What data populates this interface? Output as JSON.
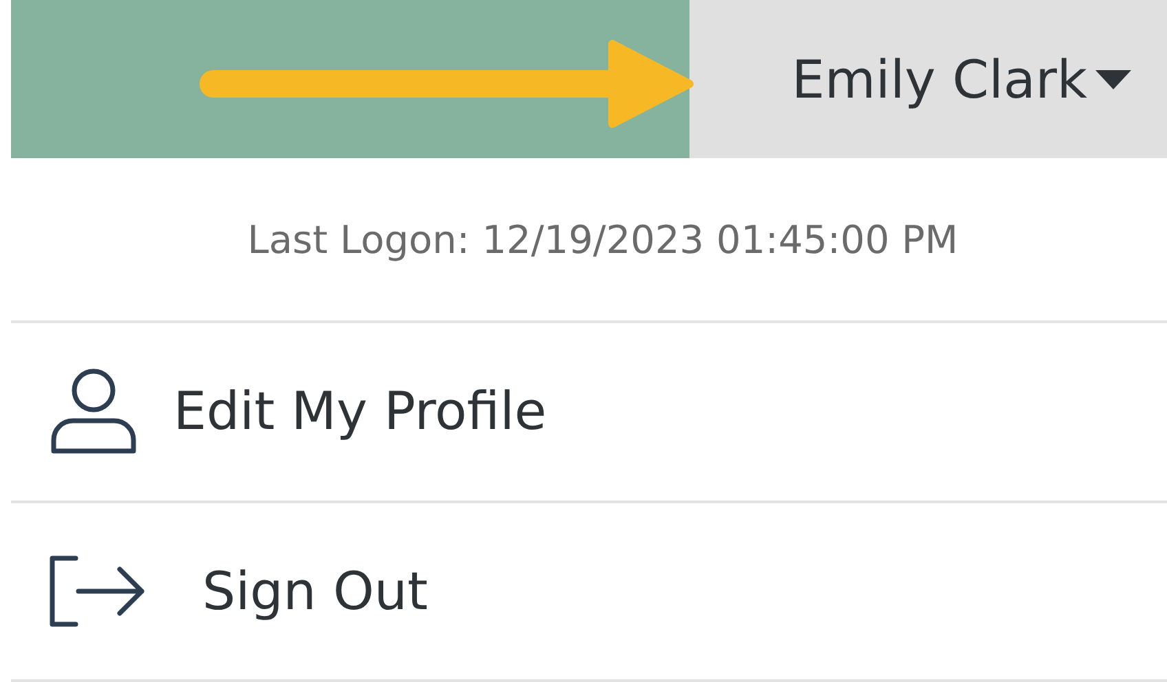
{
  "header": {
    "user_name": "Emily Clark"
  },
  "menu": {
    "last_logon": "Last Logon: 12/19/2023 01:45:00 PM",
    "items": [
      {
        "kind": "profile",
        "label": "Edit My Profile"
      },
      {
        "kind": "sign_out",
        "label": "Sign Out"
      }
    ]
  }
}
